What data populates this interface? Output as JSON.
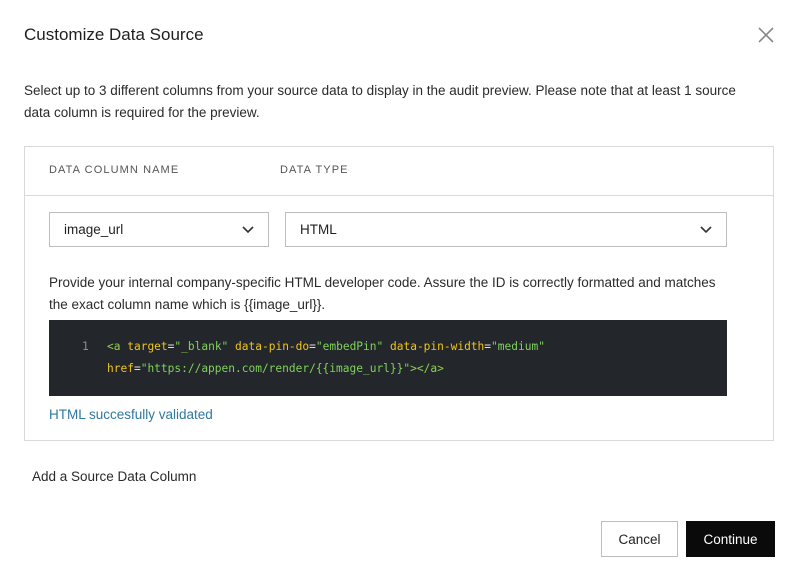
{
  "dialog": {
    "title": "Customize Data Source",
    "description": "Select up to 3 different columns from your source data to display in the audit preview. Please note that at least 1 source data column is required for the preview."
  },
  "table": {
    "col_name_header": "DATA COLUMN NAME",
    "col_type_header": "DATA TYPE",
    "row": {
      "column_value": "image_url",
      "type_value": "HTML",
      "help_text": "Provide your internal company-specific HTML developer code. Assure the ID is correctly formatted and matches the exact column name which is {{image_url}}.",
      "code": {
        "line_number": "1",
        "tag_open": "<a",
        "attr1": "target",
        "val1": "\"_blank\"",
        "attr2": "data-pin-do",
        "val2": "\"embedPin\"",
        "attr3": "data-pin-width",
        "val3": "\"medium\"",
        "attr4": "href",
        "val4": "\"https://appen.com/render/{{image_url}}\"",
        "tag_close": "></a>"
      },
      "validation_message": "HTML succesfully validated"
    }
  },
  "add_column_label": "Add a Source Data Column",
  "buttons": {
    "cancel": "Cancel",
    "continue": "Continue"
  },
  "icons": {
    "close": "close-icon",
    "dropdown": "chevron-down-icon"
  },
  "colors": {
    "primary_button": "#0a0a0a",
    "validation": "#2f78a0",
    "code_background": "#23262b"
  }
}
